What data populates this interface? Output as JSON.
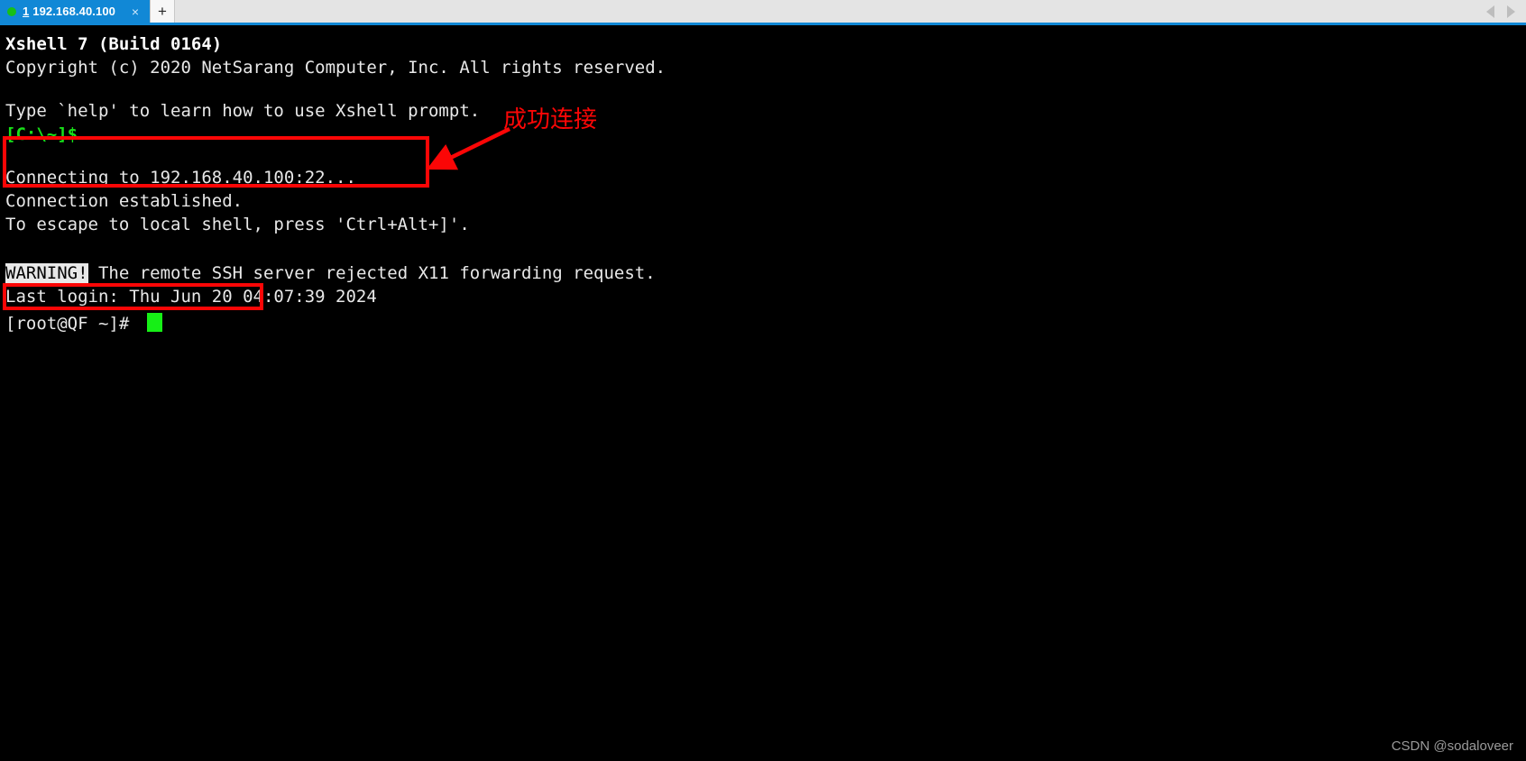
{
  "window": {
    "app_title": "Xshell 7",
    "accent_color": "#1188d6",
    "terminal_bg": "#000000",
    "terminal_fg": "#e8e8e8",
    "annotation_color": "#fb0606",
    "cursor_color": "#16ef16"
  },
  "tabbar": {
    "tabs": [
      {
        "index": "1",
        "title": "192.168.40.100",
        "status_dot": "green-dot-icon",
        "close_label": "×",
        "active": true
      }
    ],
    "new_tab_label": "+",
    "scroll_left_icon": "chevron-left-icon",
    "scroll_right_icon": "chevron-right-icon"
  },
  "terminal": {
    "lines": [
      {
        "text": "Xshell 7 (Build 0164)",
        "style": "bold"
      },
      {
        "text": "Copyright (c) 2020 NetSarang Computer, Inc. All rights reserved.",
        "style": "normal"
      },
      {
        "text": "",
        "style": "normal"
      },
      {
        "text": "Type `help' to learn how to use Xshell prompt.",
        "style": "normal"
      },
      {
        "text": "[C:\\~]$",
        "style": "green"
      },
      {
        "text": "",
        "style": "normal"
      },
      {
        "text": "Connecting to 192.168.40.100:22...",
        "style": "normal"
      },
      {
        "text": "Connection established.",
        "style": "normal"
      },
      {
        "text": "To escape to local shell, press 'Ctrl+Alt+]'.",
        "style": "normal"
      },
      {
        "text": "",
        "style": "normal"
      },
      {
        "text": "",
        "style": "normal"
      },
      {
        "text": "The remote SSH server rejected X11 forwarding request.",
        "style": "warning",
        "badge": "WARNING!"
      },
      {
        "text": "Last login: Thu Jun 20 04:07:39 2024",
        "style": "normal"
      },
      {
        "text": "[root@QF ~]# ",
        "style": "normal"
      }
    ],
    "prompt": "[root@QF ~]#",
    "cursor": "block-cursor"
  },
  "annotations": {
    "label": "成功连接",
    "arrow": "arrow-pointing-down-left-icon",
    "boxes": [
      {
        "name": "connection-established-highlight"
      },
      {
        "name": "root-prompt-highlight"
      }
    ]
  },
  "watermark": {
    "text": "CSDN @sodaloveer"
  }
}
